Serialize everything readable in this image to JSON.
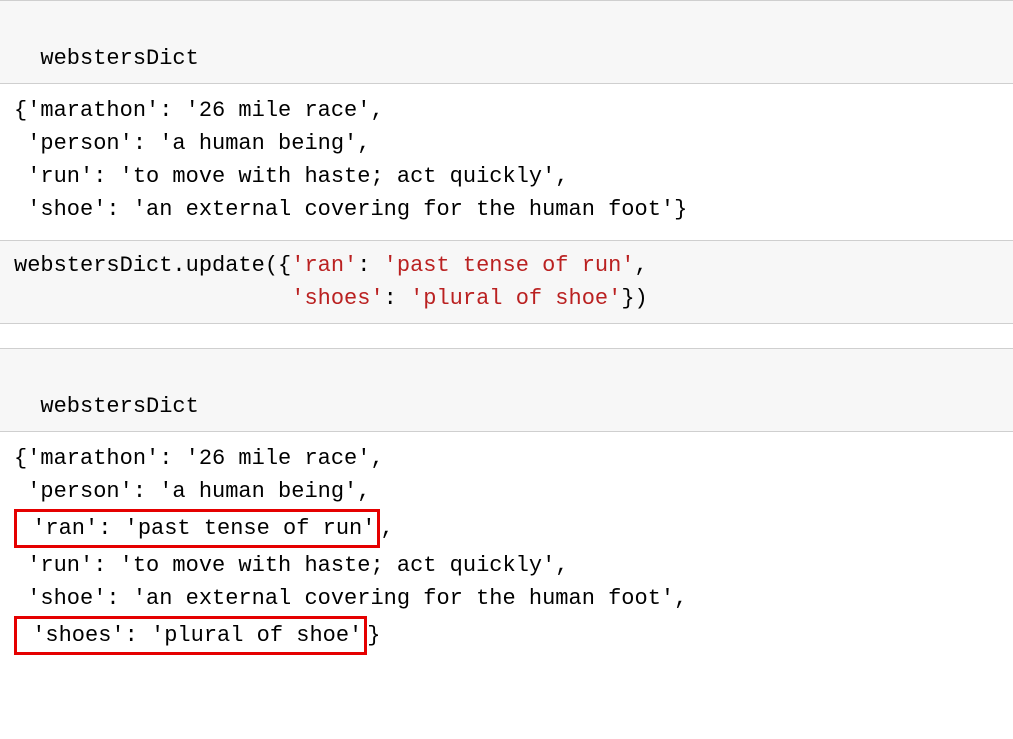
{
  "cell1": {
    "input": "webstersDict",
    "out_line1": "{'marathon': '26 mile race',",
    "out_line2": " 'person': 'a human being',",
    "out_line3": " 'run': 'to move with haste; act quickly',",
    "out_line4": " 'shoe': 'an external covering for the human foot'}"
  },
  "cell2": {
    "prefix": "webstersDict.update({",
    "k1": "'ran'",
    "sep1": ": ",
    "v1": "'past tense of run'",
    "mid": ",",
    "indent": "                     ",
    "k2": "'shoes'",
    "sep2": ": ",
    "v2": "'plural of shoe'",
    "suffix": "})"
  },
  "cell3": {
    "input": "webstersDict",
    "out_line1": "{'marathon': '26 mile race',",
    "out_line2": " 'person': 'a human being',",
    "hl1": " 'ran': 'past tense of run'",
    "after_hl1": ",",
    "out_line4": " 'run': 'to move with haste; act quickly',",
    "out_line5": " 'shoe': 'an external covering for the human foot',",
    "hl2": " 'shoes': 'plural of shoe'",
    "after_hl2": "}"
  }
}
